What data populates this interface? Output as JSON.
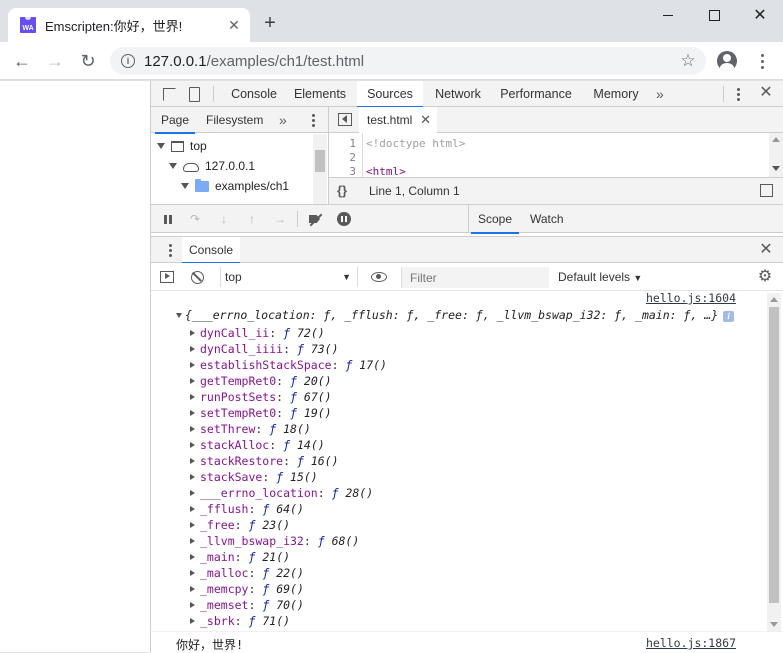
{
  "browser": {
    "tab_title": "Emscripten:你好，世界!",
    "tab_favicon_text": "WA",
    "url_host": "127.0.0.1",
    "url_path": "/examples/ch1/test.html"
  },
  "devtools": {
    "tabs": [
      "Console",
      "Elements",
      "Sources",
      "Network",
      "Performance",
      "Memory"
    ],
    "active_tab": "Sources",
    "sources": {
      "navigator_tabs": [
        "Page",
        "Filesystem"
      ],
      "tree": {
        "top": "top",
        "host": "127.0.0.1",
        "folder": "examples/ch1"
      },
      "file_tab": "test.html",
      "code_lines": [
        {
          "num": "1",
          "text": "<!doctype html>"
        },
        {
          "num": "2",
          "text": ""
        },
        {
          "num": "3",
          "text": "<html>"
        }
      ],
      "status": "Line 1, Column 1",
      "side_tabs": [
        "Scope",
        "Watch"
      ]
    },
    "drawer": {
      "tab": "Console",
      "context": "top",
      "filter_placeholder": "Filter",
      "levels": "Default levels"
    },
    "console": {
      "source1": "hello.js:1604",
      "object_summary": "{___errno_location: ƒ, _fflush: ƒ, _free: ƒ, _llvm_bswap_i32: ƒ, _main: ƒ, …}",
      "properties": [
        {
          "key": "dynCall_ii",
          "sig": "72()"
        },
        {
          "key": "dynCall_iiii",
          "sig": "73()"
        },
        {
          "key": "establishStackSpace",
          "sig": "17()"
        },
        {
          "key": "getTempRet0",
          "sig": "20()"
        },
        {
          "key": "runPostSets",
          "sig": "67()"
        },
        {
          "key": "setTempRet0",
          "sig": "19()"
        },
        {
          "key": "setThrew",
          "sig": "18()"
        },
        {
          "key": "stackAlloc",
          "sig": "14()"
        },
        {
          "key": "stackRestore",
          "sig": "16()"
        },
        {
          "key": "stackSave",
          "sig": "15()"
        },
        {
          "key": "___errno_location",
          "sig": "28()"
        },
        {
          "key": "_fflush",
          "sig": "64()"
        },
        {
          "key": "_free",
          "sig": "23()"
        },
        {
          "key": "_llvm_bswap_i32",
          "sig": "68()"
        },
        {
          "key": "_main",
          "sig": "21()"
        },
        {
          "key": "_malloc",
          "sig": "22()"
        },
        {
          "key": "_memcpy",
          "sig": "69()"
        },
        {
          "key": "_memset",
          "sig": "70()"
        },
        {
          "key": "_sbrk",
          "sig": "71()"
        }
      ],
      "message": "你好，世界!",
      "source2": "hello.js:1867"
    }
  }
}
